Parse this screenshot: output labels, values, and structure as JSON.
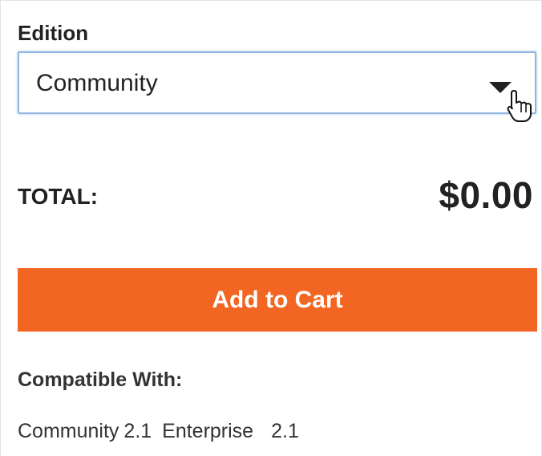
{
  "edition": {
    "label": "Edition",
    "selected": "Community"
  },
  "total": {
    "label": "TOTAL:",
    "value": "$0.00"
  },
  "cart": {
    "button_label": "Add to Cart",
    "button_color": "#f26522"
  },
  "compatible": {
    "label": "Compatible With:",
    "items": [
      {
        "name": "Community",
        "version": "2.1"
      },
      {
        "name": "Enterprise",
        "version": "2.1"
      }
    ]
  },
  "icons": {
    "dropdown": "caret-down-icon",
    "cursor": "hand-pointer-icon"
  }
}
